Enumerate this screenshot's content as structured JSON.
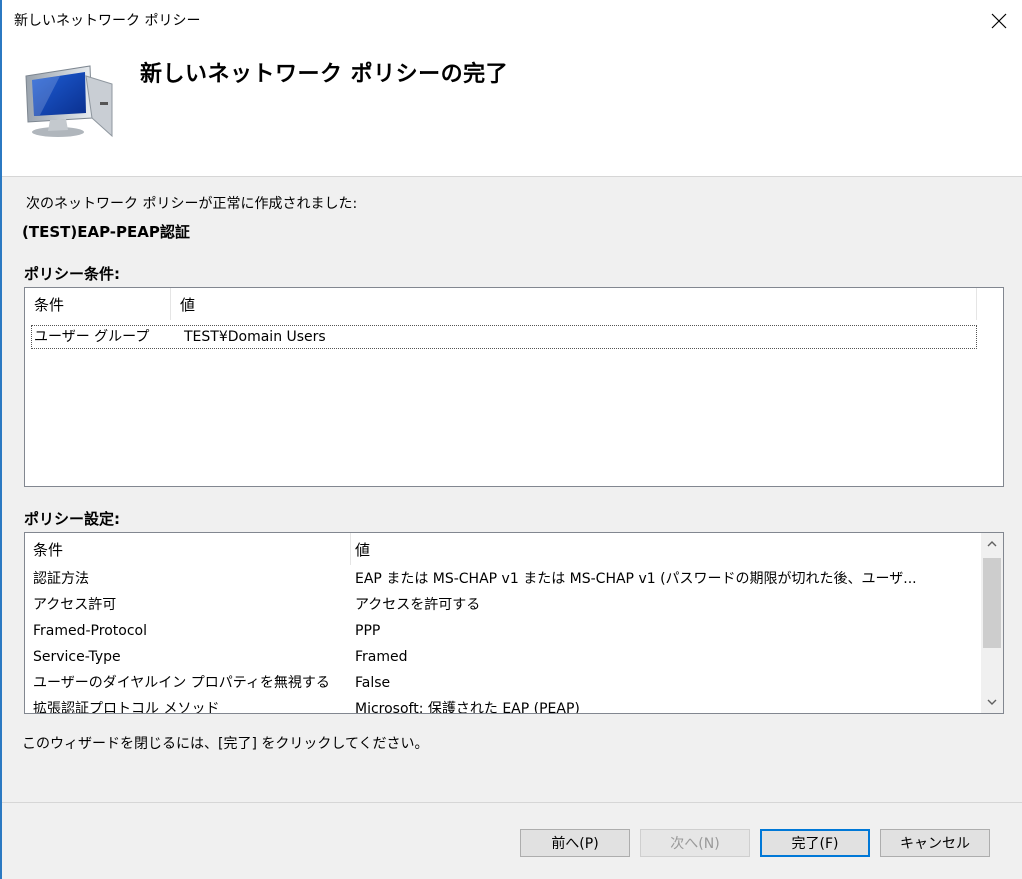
{
  "window": {
    "title": "新しいネットワーク ポリシー",
    "heading": "新しいネットワーク ポリシーの完了"
  },
  "content": {
    "message": "次のネットワーク ポリシーが正常に作成されました:",
    "policy_name": "(TEST)EAP-PEAP認証",
    "conditions_label": "ポリシー条件:",
    "conditions": {
      "columns": [
        "条件",
        "値"
      ],
      "rows": [
        {
          "condition": "ユーザー グループ",
          "value": "TEST¥Domain Users"
        }
      ]
    },
    "settings_label": "ポリシー設定:",
    "settings": {
      "columns": [
        "条件",
        "値"
      ],
      "rows": [
        {
          "condition": "認証方法",
          "value": "EAP または MS-CHAP v1 または MS-CHAP v1 (パスワードの期限が切れた後、ユーザ..."
        },
        {
          "condition": "アクセス許可",
          "value": "アクセスを許可する"
        },
        {
          "condition": "Framed-Protocol",
          "value": "PPP"
        },
        {
          "condition": "Service-Type",
          "value": "Framed"
        },
        {
          "condition": "ユーザーのダイヤルイン プロパティを無視する",
          "value": "False"
        },
        {
          "condition": "拡張認証プロトコル メソッド",
          "value": "Microsoft: 保護された EAP (PEAP)"
        }
      ]
    },
    "hint": "このウィザードを閉じるには、[完了] をクリックしてください。"
  },
  "buttons": {
    "back": "前へ(P)",
    "next": "次へ(N)",
    "finish": "完了(F)",
    "cancel": "キャンセル"
  },
  "icons": {
    "close": "close-icon",
    "wizard": "computer-monitor-icon"
  }
}
